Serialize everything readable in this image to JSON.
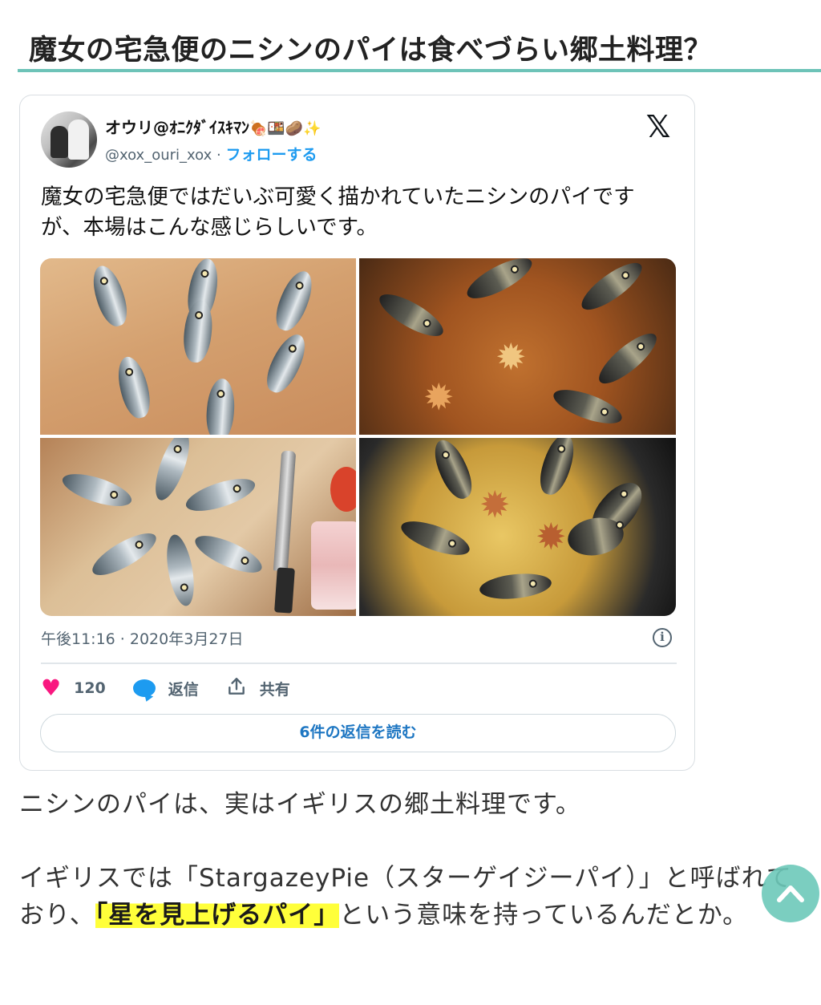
{
  "article": {
    "heading": "魔女の宅急便のニシンのパイは食べづらい郷土料理？"
  },
  "tweet": {
    "author_name": "オウリ@ｵﾆｸﾀﾞｲｽｷﾏﾝ",
    "author_emoji": "🍖🍱🥔✨",
    "handle": "@xox_ouri_xox",
    "separator": "·",
    "follow_label": "フォローする",
    "platform_icon": "x-logo-icon",
    "text": "魔女の宅急便ではだいぶ可愛く描かれていたニシンのパイですが、本場はこんな感じらしいです。",
    "images": [
      {
        "name": "photo-herring-heads-in-dough"
      },
      {
        "name": "photo-baked-pie-with-fish-heads"
      },
      {
        "name": "photo-raw-fish-on-dough-with-knife"
      },
      {
        "name": "photo-golden-pie-with-fish-heads"
      }
    ],
    "timestamp": "午後11:16 · 2020年3月27日",
    "likes_count": "120",
    "reply_label": "返信",
    "share_label": "共有",
    "read_replies_label": "6件の返信を読む"
  },
  "body": {
    "para1": "ニシンのパイは、実はイギリスの郷土料理です。",
    "para2_before": "イギリスでは「StargazeyPie（スターゲイジーパイ）」と呼ばれており、",
    "para2_highlight": "「星を見上げるパイ」",
    "para2_after": "という意味を持っているんだとか。"
  },
  "colors": {
    "accent": "#6dc3b8",
    "link": "#1d9bf0",
    "like": "#f91880",
    "highlight": "#ffff3a"
  }
}
